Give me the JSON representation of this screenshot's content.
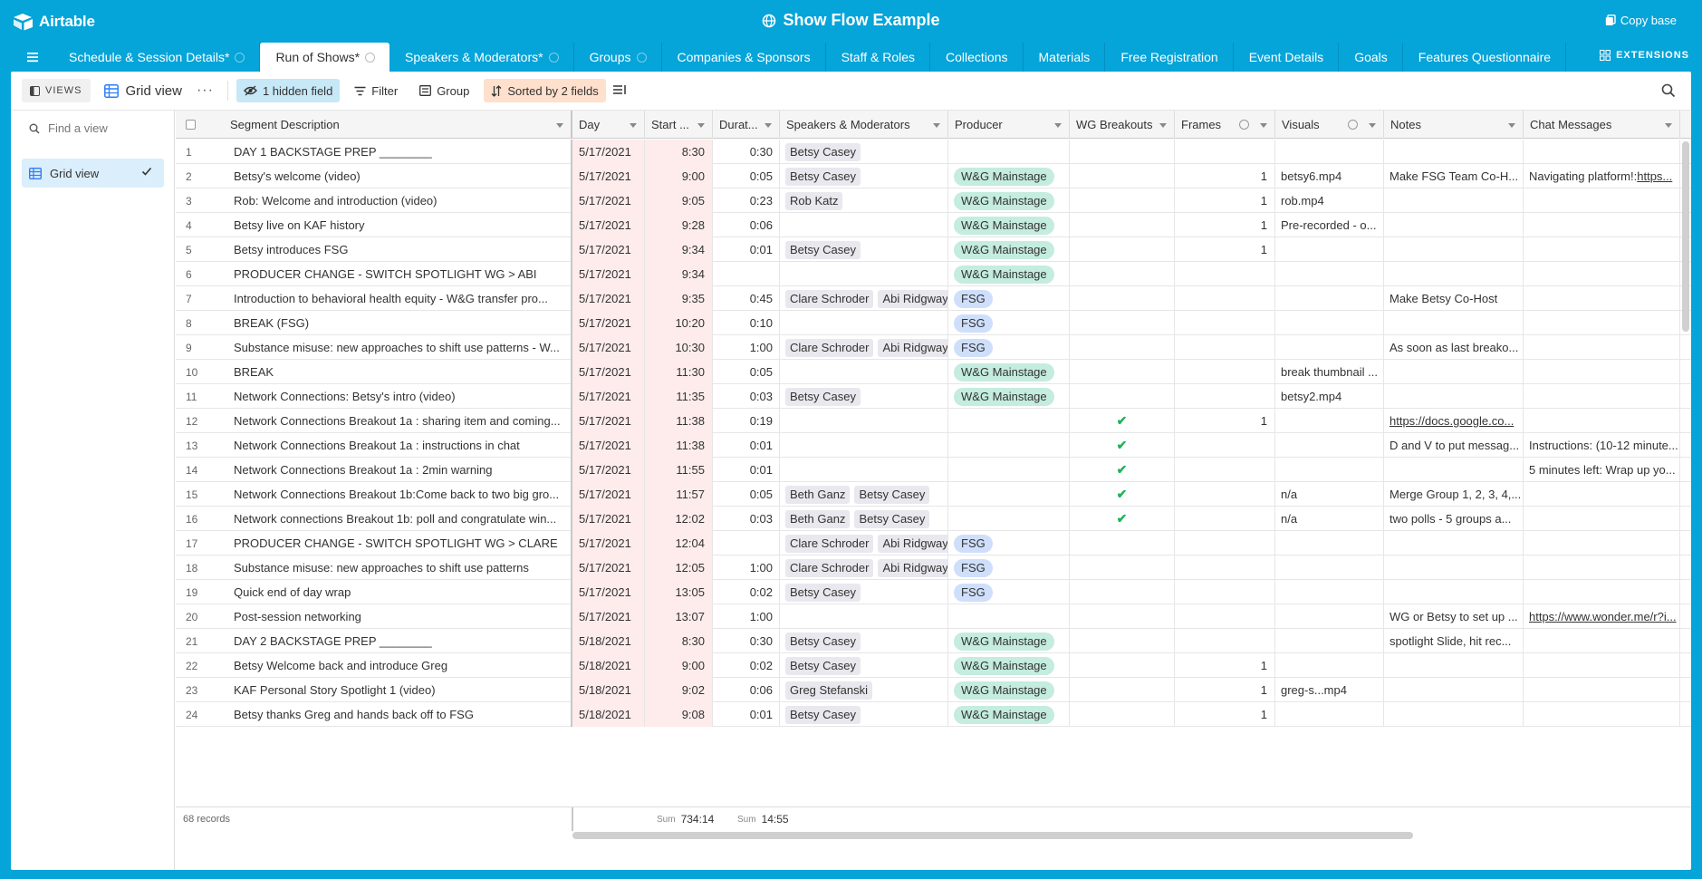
{
  "app": {
    "name": "Airtable",
    "base_title": "Show Flow Example",
    "copy_base": "Copy base"
  },
  "tabs": [
    {
      "label": "Schedule & Session Details*",
      "info": true,
      "active": false
    },
    {
      "label": "Run of Shows*",
      "info": true,
      "active": true
    },
    {
      "label": "Speakers & Moderators*",
      "info": true,
      "active": false
    },
    {
      "label": "Groups",
      "info": true,
      "active": false
    },
    {
      "label": "Companies & Sponsors",
      "info": false,
      "active": false
    },
    {
      "label": "Staff & Roles",
      "info": false,
      "active": false
    },
    {
      "label": "Collections",
      "info": false,
      "active": false
    },
    {
      "label": "Materials",
      "info": false,
      "active": false
    },
    {
      "label": "Free Registration",
      "info": false,
      "active": false
    },
    {
      "label": "Event Details",
      "info": false,
      "active": false
    },
    {
      "label": "Goals",
      "info": false,
      "active": false
    },
    {
      "label": "Features Questionnaire",
      "info": false,
      "active": false
    }
  ],
  "extensions_label": "EXTENSIONS",
  "toolbar": {
    "views": "VIEWS",
    "view_name": "Grid view",
    "hidden_field": "1 hidden field",
    "filter": "Filter",
    "group": "Group",
    "sorted": "Sorted by 2 fields"
  },
  "sidebar": {
    "find_placeholder": "Find a view",
    "view_item": "Grid view"
  },
  "columns": {
    "segment": "Segment Description",
    "day": "Day",
    "start": "Start ...",
    "duration": "Durat...",
    "speakers": "Speakers & Moderators",
    "producer": "Producer",
    "wg": "WG Breakouts",
    "frames": "Frames",
    "visuals": "Visuals",
    "notes": "Notes",
    "chat": "Chat Messages"
  },
  "rows": [
    {
      "n": "1",
      "seg": "DAY 1 BACKSTAGE PREP ________",
      "day": "5/17/2021",
      "start": "8:30",
      "dur": "0:30",
      "speakers": [
        "Betsy Casey"
      ],
      "producer": "",
      "wg": false,
      "frames": "",
      "visuals": "",
      "notes": "",
      "notes_link": false,
      "chat": "",
      "chat_link": ""
    },
    {
      "n": "2",
      "seg": "Betsy's welcome (video)",
      "day": "5/17/2021",
      "start": "9:00",
      "dur": "0:05",
      "speakers": [
        "Betsy Casey"
      ],
      "producer": "W&G Mainstage",
      "wg": false,
      "frames": "1",
      "visuals": "betsy6.mp4",
      "notes": "Make FSG Team Co-H...",
      "notes_link": false,
      "chat": "Navigating platform!: ",
      "chat_link": "https..."
    },
    {
      "n": "3",
      "seg": "Rob: Welcome and introduction (video)",
      "day": "5/17/2021",
      "start": "9:05",
      "dur": "0:23",
      "speakers": [
        "Rob Katz"
      ],
      "producer": "W&G Mainstage",
      "wg": false,
      "frames": "1",
      "visuals": "rob.mp4",
      "notes": "",
      "notes_link": false,
      "chat": "",
      "chat_link": ""
    },
    {
      "n": "4",
      "seg": "Betsy live on KAF history",
      "day": "5/17/2021",
      "start": "9:28",
      "dur": "0:06",
      "speakers": [],
      "producer": "W&G Mainstage",
      "wg": false,
      "frames": "1",
      "visuals": "Pre-recorded - o...",
      "notes": "",
      "notes_link": false,
      "chat": "",
      "chat_link": ""
    },
    {
      "n": "5",
      "seg": "Betsy introduces FSG",
      "day": "5/17/2021",
      "start": "9:34",
      "dur": "0:01",
      "speakers": [
        "Betsy Casey"
      ],
      "producer": "W&G Mainstage",
      "wg": false,
      "frames": "1",
      "visuals": "",
      "notes": "",
      "notes_link": false,
      "chat": "",
      "chat_link": ""
    },
    {
      "n": "6",
      "seg": "PRODUCER CHANGE - SWITCH SPOTLIGHT WG > ABI",
      "day": "5/17/2021",
      "start": "9:34",
      "dur": "",
      "speakers": [],
      "producer": "W&G Mainstage",
      "wg": false,
      "frames": "",
      "visuals": "",
      "notes": "",
      "notes_link": false,
      "chat": "",
      "chat_link": ""
    },
    {
      "n": "7",
      "seg": "Introduction to behavioral health equity - W&G transfer pro...",
      "day": "5/17/2021",
      "start": "9:35",
      "dur": "0:45",
      "speakers": [
        "Clare Schroder",
        "Abi Ridgway"
      ],
      "producer": "FSG",
      "wg": false,
      "frames": "",
      "visuals": "",
      "notes": "Make Betsy Co-Host",
      "notes_link": false,
      "chat": "",
      "chat_link": ""
    },
    {
      "n": "8",
      "seg": "BREAK (FSG)",
      "day": "5/17/2021",
      "start": "10:20",
      "dur": "0:10",
      "speakers": [],
      "producer": "FSG",
      "wg": false,
      "frames": "",
      "visuals": "",
      "notes": "",
      "notes_link": false,
      "chat": "",
      "chat_link": ""
    },
    {
      "n": "9",
      "seg": "Substance misuse: new approaches to shift use patterns - W...",
      "day": "5/17/2021",
      "start": "10:30",
      "dur": "1:00",
      "speakers": [
        "Clare Schroder",
        "Abi Ridgway"
      ],
      "producer": "FSG",
      "wg": false,
      "frames": "",
      "visuals": "",
      "notes": "As soon as last breako...",
      "notes_link": false,
      "chat": "",
      "chat_link": ""
    },
    {
      "n": "10",
      "seg": "BREAK",
      "day": "5/17/2021",
      "start": "11:30",
      "dur": "0:05",
      "speakers": [],
      "producer": "W&G Mainstage",
      "wg": false,
      "frames": "",
      "visuals": "break thumbnail ...",
      "notes": "",
      "notes_link": false,
      "chat": "",
      "chat_link": ""
    },
    {
      "n": "11",
      "seg": "Network Connections: Betsy's intro (video)",
      "day": "5/17/2021",
      "start": "11:35",
      "dur": "0:03",
      "speakers": [
        "Betsy Casey"
      ],
      "producer": "W&G Mainstage",
      "wg": false,
      "frames": "",
      "visuals": "betsy2.mp4",
      "notes": "",
      "notes_link": false,
      "chat": "",
      "chat_link": ""
    },
    {
      "n": "12",
      "seg": "Network Connections Breakout 1a : sharing item and coming...",
      "day": "5/17/2021",
      "start": "11:38",
      "dur": "0:19",
      "speakers": [],
      "producer": "",
      "wg": true,
      "frames": "1",
      "visuals": "",
      "notes": "https://docs.google.co...",
      "notes_link": true,
      "chat": "",
      "chat_link": ""
    },
    {
      "n": "13",
      "seg": "Network Connections Breakout 1a : instructions in chat",
      "day": "5/17/2021",
      "start": "11:38",
      "dur": "0:01",
      "speakers": [],
      "producer": "",
      "wg": true,
      "frames": "",
      "visuals": "",
      "notes": "D and V to put messag...",
      "notes_link": false,
      "chat": "Instructions: (10-12 minute...",
      "chat_link": ""
    },
    {
      "n": "14",
      "seg": "Network Connections Breakout 1a : 2min warning",
      "day": "5/17/2021",
      "start": "11:55",
      "dur": "0:01",
      "speakers": [],
      "producer": "",
      "wg": true,
      "frames": "",
      "visuals": "",
      "notes": "",
      "notes_link": false,
      "chat": "5 minutes left: Wrap up yo...",
      "chat_link": ""
    },
    {
      "n": "15",
      "seg": "Network Connections Breakout 1b:Come back to two big gro...",
      "day": "5/17/2021",
      "start": "11:57",
      "dur": "0:05",
      "speakers": [
        "Beth Ganz",
        "Betsy Casey"
      ],
      "producer": "",
      "wg": true,
      "frames": "",
      "visuals": "n/a",
      "notes": "Merge Group 1, 2, 3, 4,...",
      "notes_link": false,
      "chat": "",
      "chat_link": ""
    },
    {
      "n": "16",
      "seg": "Network connections Breakout 1b: poll and congratulate win...",
      "day": "5/17/2021",
      "start": "12:02",
      "dur": "0:03",
      "speakers": [
        "Beth Ganz",
        "Betsy Casey"
      ],
      "producer": "",
      "wg": true,
      "frames": "",
      "visuals": "n/a",
      "notes": "two polls - 5 groups a...",
      "notes_link": false,
      "chat": "",
      "chat_link": ""
    },
    {
      "n": "17",
      "seg": "PRODUCER CHANGE - SWITCH SPOTLIGHT WG > CLARE",
      "day": "5/17/2021",
      "start": "12:04",
      "dur": "",
      "speakers": [
        "Clare Schroder",
        "Abi Ridgway"
      ],
      "producer": "FSG",
      "wg": false,
      "frames": "",
      "visuals": "",
      "notes": "",
      "notes_link": false,
      "chat": "",
      "chat_link": ""
    },
    {
      "n": "18",
      "seg": "Substance misuse: new approaches to shift use patterns",
      "day": "5/17/2021",
      "start": "12:05",
      "dur": "1:00",
      "speakers": [
        "Clare Schroder",
        "Abi Ridgway"
      ],
      "producer": "FSG",
      "wg": false,
      "frames": "",
      "visuals": "",
      "notes": "",
      "notes_link": false,
      "chat": "",
      "chat_link": ""
    },
    {
      "n": "19",
      "seg": "Quick end of day wrap",
      "day": "5/17/2021",
      "start": "13:05",
      "dur": "0:02",
      "speakers": [
        "Betsy Casey"
      ],
      "producer": "FSG",
      "wg": false,
      "frames": "",
      "visuals": "",
      "notes": "",
      "notes_link": false,
      "chat": "",
      "chat_link": ""
    },
    {
      "n": "20",
      "seg": "Post-session networking",
      "day": "5/17/2021",
      "start": "13:07",
      "dur": "1:00",
      "speakers": [],
      "producer": "",
      "wg": false,
      "frames": "",
      "visuals": "",
      "notes": "WG or Betsy to set up ...",
      "notes_link": false,
      "chat": "",
      "chat_link": "https://www.wonder.me/r?i..."
    },
    {
      "n": "21",
      "seg": "DAY 2 BACKSTAGE PREP ________",
      "day": "5/18/2021",
      "start": "8:30",
      "dur": "0:30",
      "speakers": [
        "Betsy Casey"
      ],
      "producer": "W&G Mainstage",
      "wg": false,
      "frames": "",
      "visuals": "",
      "notes": "spotlight Slide, hit rec...",
      "notes_link": false,
      "chat": "",
      "chat_link": ""
    },
    {
      "n": "22",
      "seg": "Betsy Welcome back and introduce Greg",
      "day": "5/18/2021",
      "start": "9:00",
      "dur": "0:02",
      "speakers": [
        "Betsy Casey"
      ],
      "producer": "W&G Mainstage",
      "wg": false,
      "frames": "1",
      "visuals": "",
      "notes": "",
      "notes_link": false,
      "chat": "",
      "chat_link": ""
    },
    {
      "n": "23",
      "seg": "KAF Personal Story Spotlight 1 (video)",
      "day": "5/18/2021",
      "start": "9:02",
      "dur": "0:06",
      "speakers": [
        "Greg Stefanski"
      ],
      "producer": "W&G Mainstage",
      "wg": false,
      "frames": "1",
      "visuals": "greg-s...mp4",
      "notes": "",
      "notes_link": false,
      "chat": "",
      "chat_link": ""
    },
    {
      "n": "24",
      "seg": "Betsy thanks Greg and hands back off to FSG",
      "day": "5/18/2021",
      "start": "9:08",
      "dur": "0:01",
      "speakers": [
        "Betsy Casey"
      ],
      "producer": "W&G Mainstage",
      "wg": false,
      "frames": "1",
      "visuals": "",
      "notes": "",
      "notes_link": false,
      "chat": "",
      "chat_link": ""
    }
  ],
  "footer": {
    "records": "68 records",
    "sum_label": "Sum",
    "start_sum": "734:14",
    "dur_sum": "14:55"
  },
  "colors": {
    "brand": "#05a4d9",
    "wg_pill": "#c4ecdf",
    "fsg_pill": "#cfdffb",
    "time_bg": "#fdeceb",
    "check": "#20b35a"
  }
}
